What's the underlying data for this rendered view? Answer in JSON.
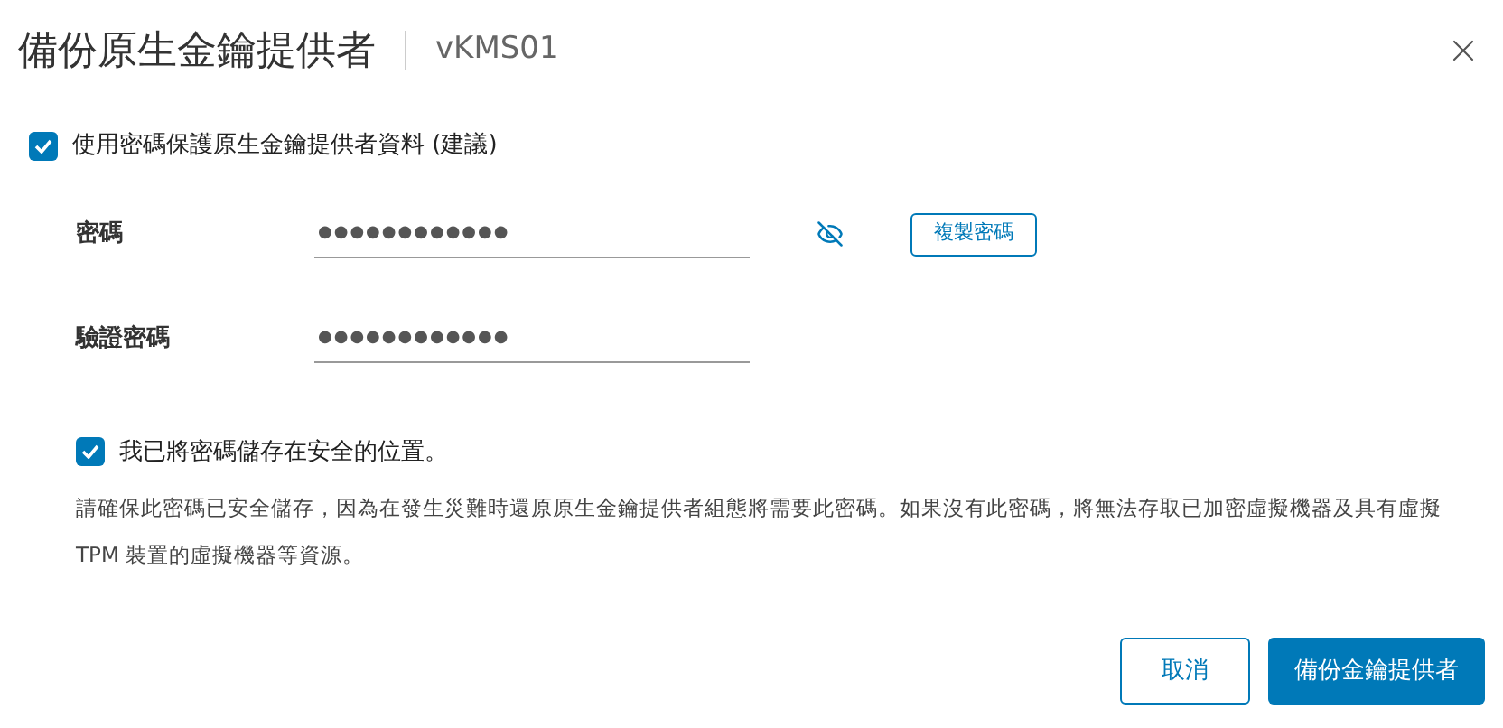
{
  "dialog": {
    "title": "備份原生金鑰提供者",
    "subtitle": "vKMS01"
  },
  "protect_option": {
    "label": "使用密碼保護原生金鑰提供者資料 (建議)",
    "checked": true
  },
  "fields": [
    {
      "label": "密碼",
      "value": "●●●●●●●●●●●●",
      "kind": "password-with-actions",
      "copy_button": "複製密碼"
    },
    {
      "label": "驗證密碼",
      "value": "●●●●●●●●●●●●",
      "kind": "password"
    }
  ],
  "saved_option": {
    "label": "我已將密碼儲存在安全的位置。",
    "checked": true
  },
  "notice": "請確保此密碼已安全儲存，因為在發生災難時還原原生金鑰提供者組態將需要此密碼。如果沒有此密碼，將無法存取已加密虛擬機器及具有虛擬 TPM 裝置的虛擬機器等資源。",
  "buttons": [
    {
      "label": "取消",
      "kind": "secondary"
    },
    {
      "label": "備份金鑰提供者",
      "kind": "primary"
    }
  ]
}
